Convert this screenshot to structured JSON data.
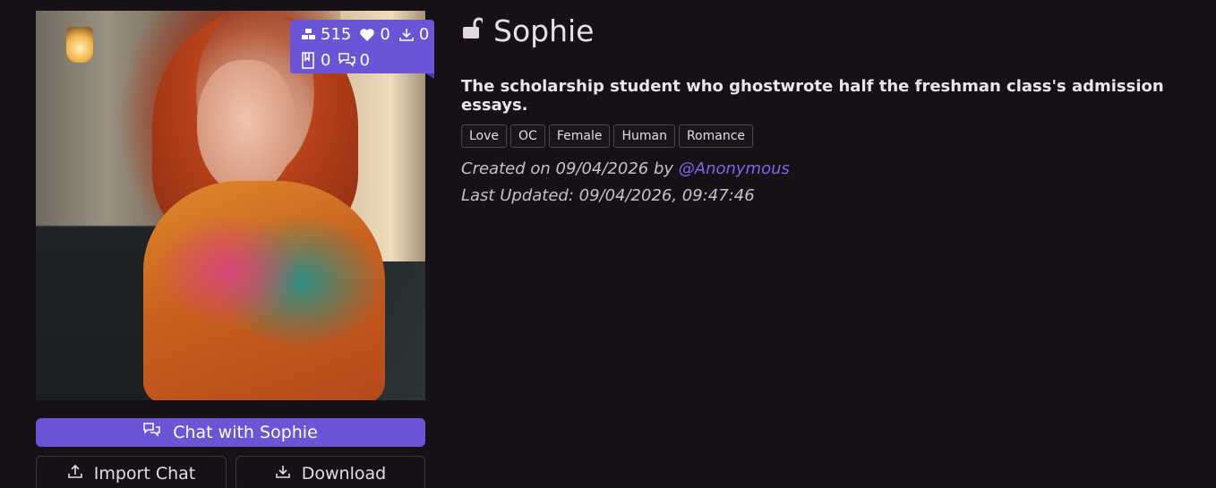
{
  "character": {
    "name": "Sophie",
    "tagline": "The scholarship student who ghostwrote half the freshman class's admission essays.",
    "tags": [
      "Love",
      "OC",
      "Female",
      "Human",
      "Romance"
    ],
    "created_prefix": "Created on 09/04/2026 by ",
    "author": "@Anonymous",
    "last_updated": "Last Updated: 09/04/2026, 09:47:46"
  },
  "stats": {
    "tokens": "515",
    "likes": "0",
    "downloads": "0",
    "lorebook": "0",
    "chats": "0"
  },
  "buttons": {
    "chat": "Chat with Sophie",
    "import": "Import Chat",
    "download": "Download"
  },
  "colors": {
    "accent": "#6b54d6",
    "background": "#151116",
    "link": "#7f67e6"
  },
  "icons": {
    "lock": "unlock-icon",
    "tokens": "tokens-icon",
    "likes": "heart-icon",
    "downloads": "download-icon",
    "lorebook": "book-icon",
    "chats": "chat-bubbles-icon"
  }
}
